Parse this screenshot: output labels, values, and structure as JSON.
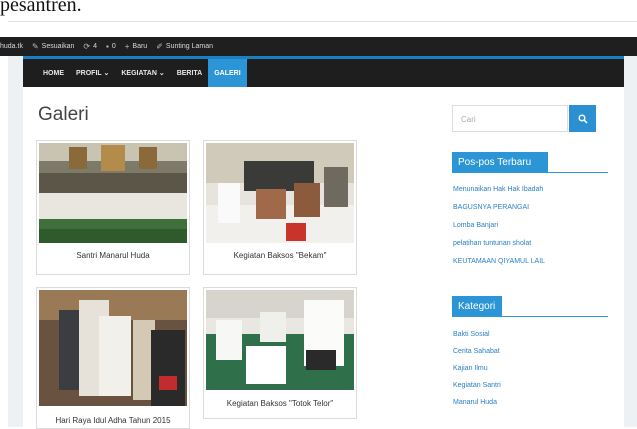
{
  "document": {
    "top_text": "pesantren."
  },
  "admin_bar": {
    "items": [
      {
        "icon": "home-icon",
        "label": "huda.tk"
      },
      {
        "icon": "brush-icon",
        "label": "Sesuaikan"
      },
      {
        "icon": "refresh-icon",
        "label": "4"
      },
      {
        "icon": "comment-icon",
        "label": "0"
      },
      {
        "icon": "plus-icon",
        "label": "Baru"
      },
      {
        "icon": "pencil-icon",
        "label": "Sunting Laman"
      }
    ]
  },
  "nav": {
    "items": [
      "HOME",
      "PROFIL ⌄",
      "KEGIATAN ⌄",
      "BERITA",
      "GALERI"
    ],
    "active": "GALERI",
    "accent": "#2b95d6"
  },
  "page": {
    "title": "Galeri"
  },
  "gallery": [
    {
      "caption": "Santri Manarul Huda"
    },
    {
      "caption": "Kegiatan Baksos \"Bekam\""
    },
    {
      "caption": "Hari Raya Idul Adha Tahun 2015"
    },
    {
      "caption": "Kegiatan Baksos \"Totok Telor\""
    }
  ],
  "sidebar": {
    "search": {
      "placeholder": "Cari"
    },
    "recent_posts": {
      "title": "Pos-pos Terbaru",
      "items": [
        "Menunaikan Hak Hak Ibadah",
        "BAGUSNYA PERANGAI",
        "Lomba Banjari",
        "pelatihan tuntunan sholat",
        "KEUTAMAAN QIYAMUL LAIL"
      ]
    },
    "categories": {
      "title": "Kategori",
      "items": [
        "Bakti Sosial",
        "Cerita Sahabat",
        "Kajian Ilmu",
        "Kegiatan Santri",
        "Manarul Huda"
      ]
    }
  }
}
